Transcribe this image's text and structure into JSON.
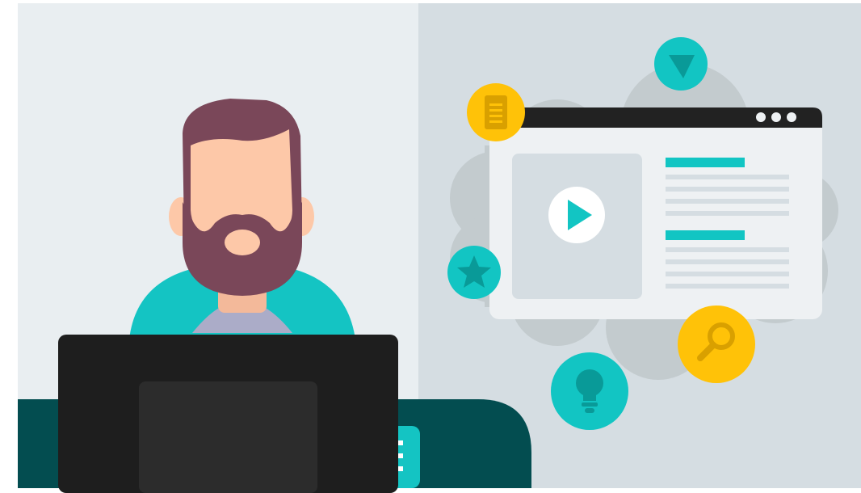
{
  "illustration": {
    "colors": {
      "left_background": "#E9EEF1",
      "right_background": "#D5DDE2",
      "cloud": "#C3CBCE",
      "desk": "#034D50",
      "laptop_outer": "#1E1E1E",
      "laptop_inner": "#2C2C2C",
      "hair_beard": "#7A4759",
      "skin": "#FDC8A8",
      "skin_shadow": "#F3B99A",
      "shirt": "#14C4C3",
      "undershirt": "#ABACC8",
      "window_bg": "#EEF1F3",
      "window_bar": "#222222",
      "video_box": "#D5DDE2",
      "teal_accent": "#12C5C3",
      "text_line": "#D5DDE2",
      "yellow": "#FFC208",
      "yellow_dark": "#D9A000",
      "teal_icon_dark": "#099A98"
    },
    "icons": [
      "play-icon",
      "document-icon",
      "send-icon",
      "star-icon",
      "search-icon",
      "lightbulb-icon",
      "app-grid-icon"
    ]
  }
}
